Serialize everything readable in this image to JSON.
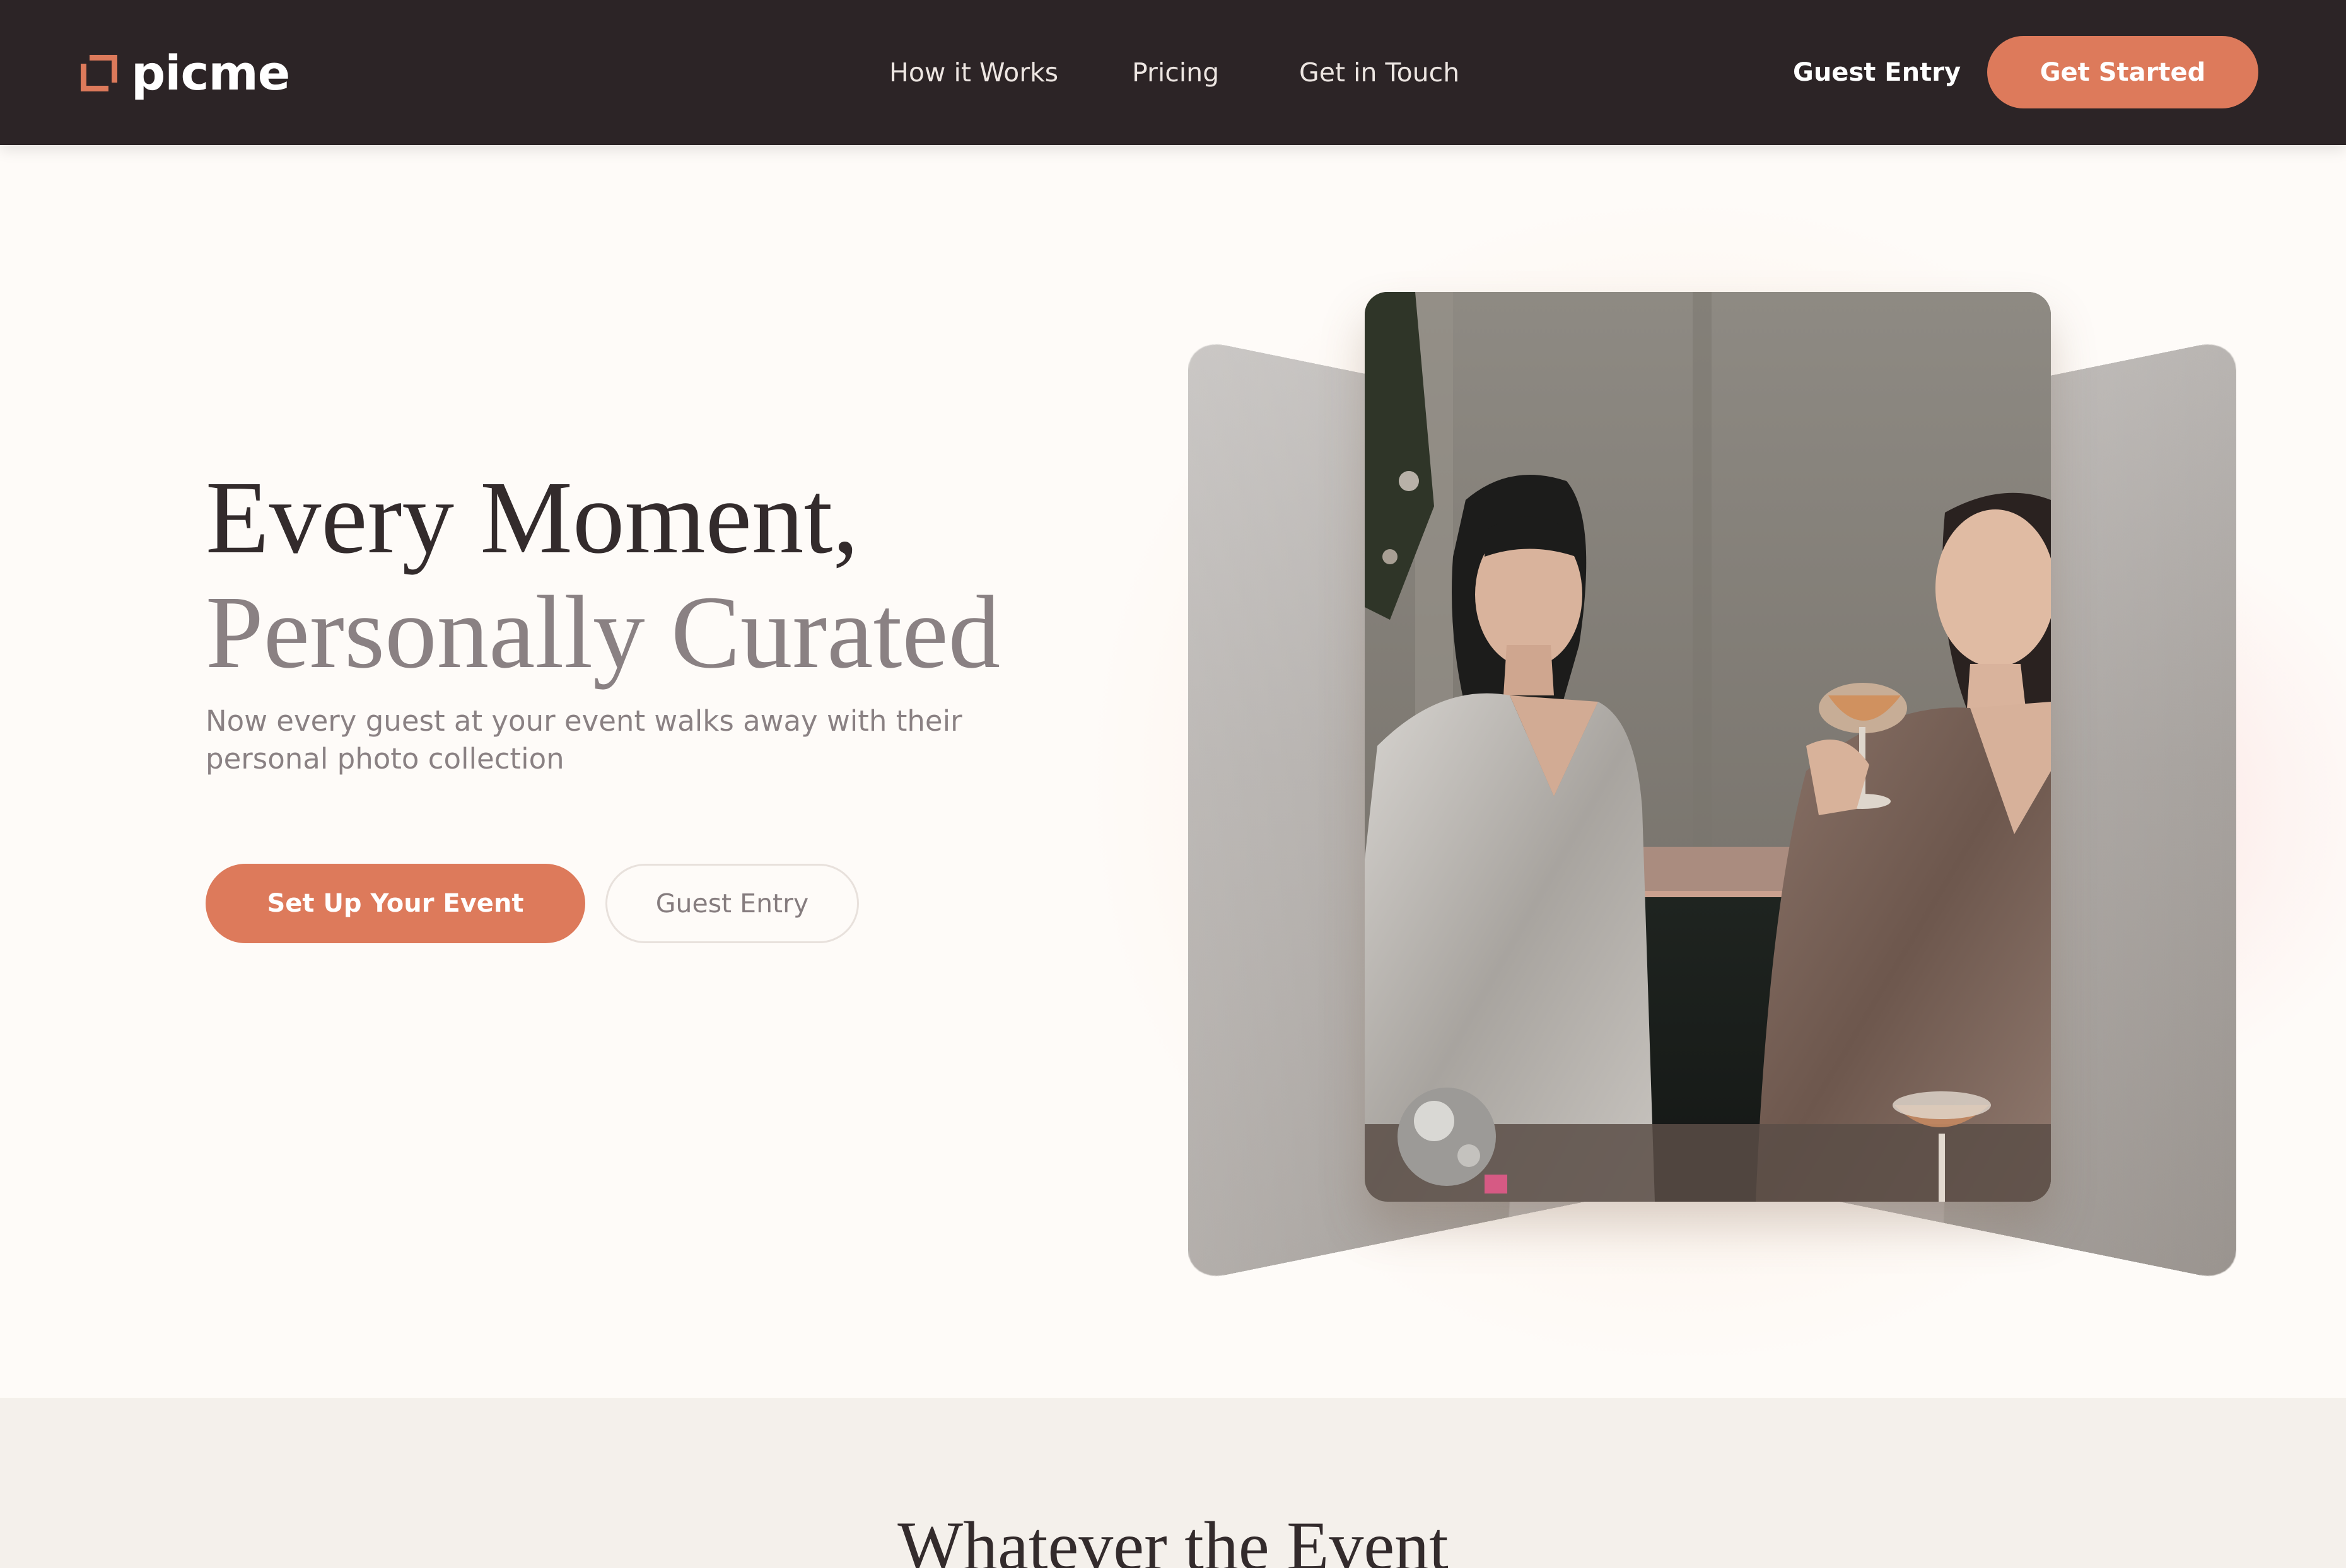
{
  "nav": {
    "logo_text": "picme",
    "links": [
      "How it Works",
      "Pricing",
      "Get in Touch"
    ],
    "guest_entry": "Guest Entry",
    "get_started": "Get Started"
  },
  "hero": {
    "title_line1": "Every Moment,",
    "title_line2": "Personally Curated",
    "subtitle": "Now every guest at your event walks away with their personal photo collection",
    "primary_button": "Set Up Your Event",
    "secondary_button": "Guest Entry"
  },
  "section2": {
    "heading": "Whatever the Event"
  },
  "colors": {
    "nav_bg": "#2c2426",
    "accent": "#dd7a5b",
    "page_bg": "#fefbf8",
    "section_bg": "#f4f0eb",
    "title_dark": "#332b2c",
    "title_muted": "#8a8183"
  }
}
